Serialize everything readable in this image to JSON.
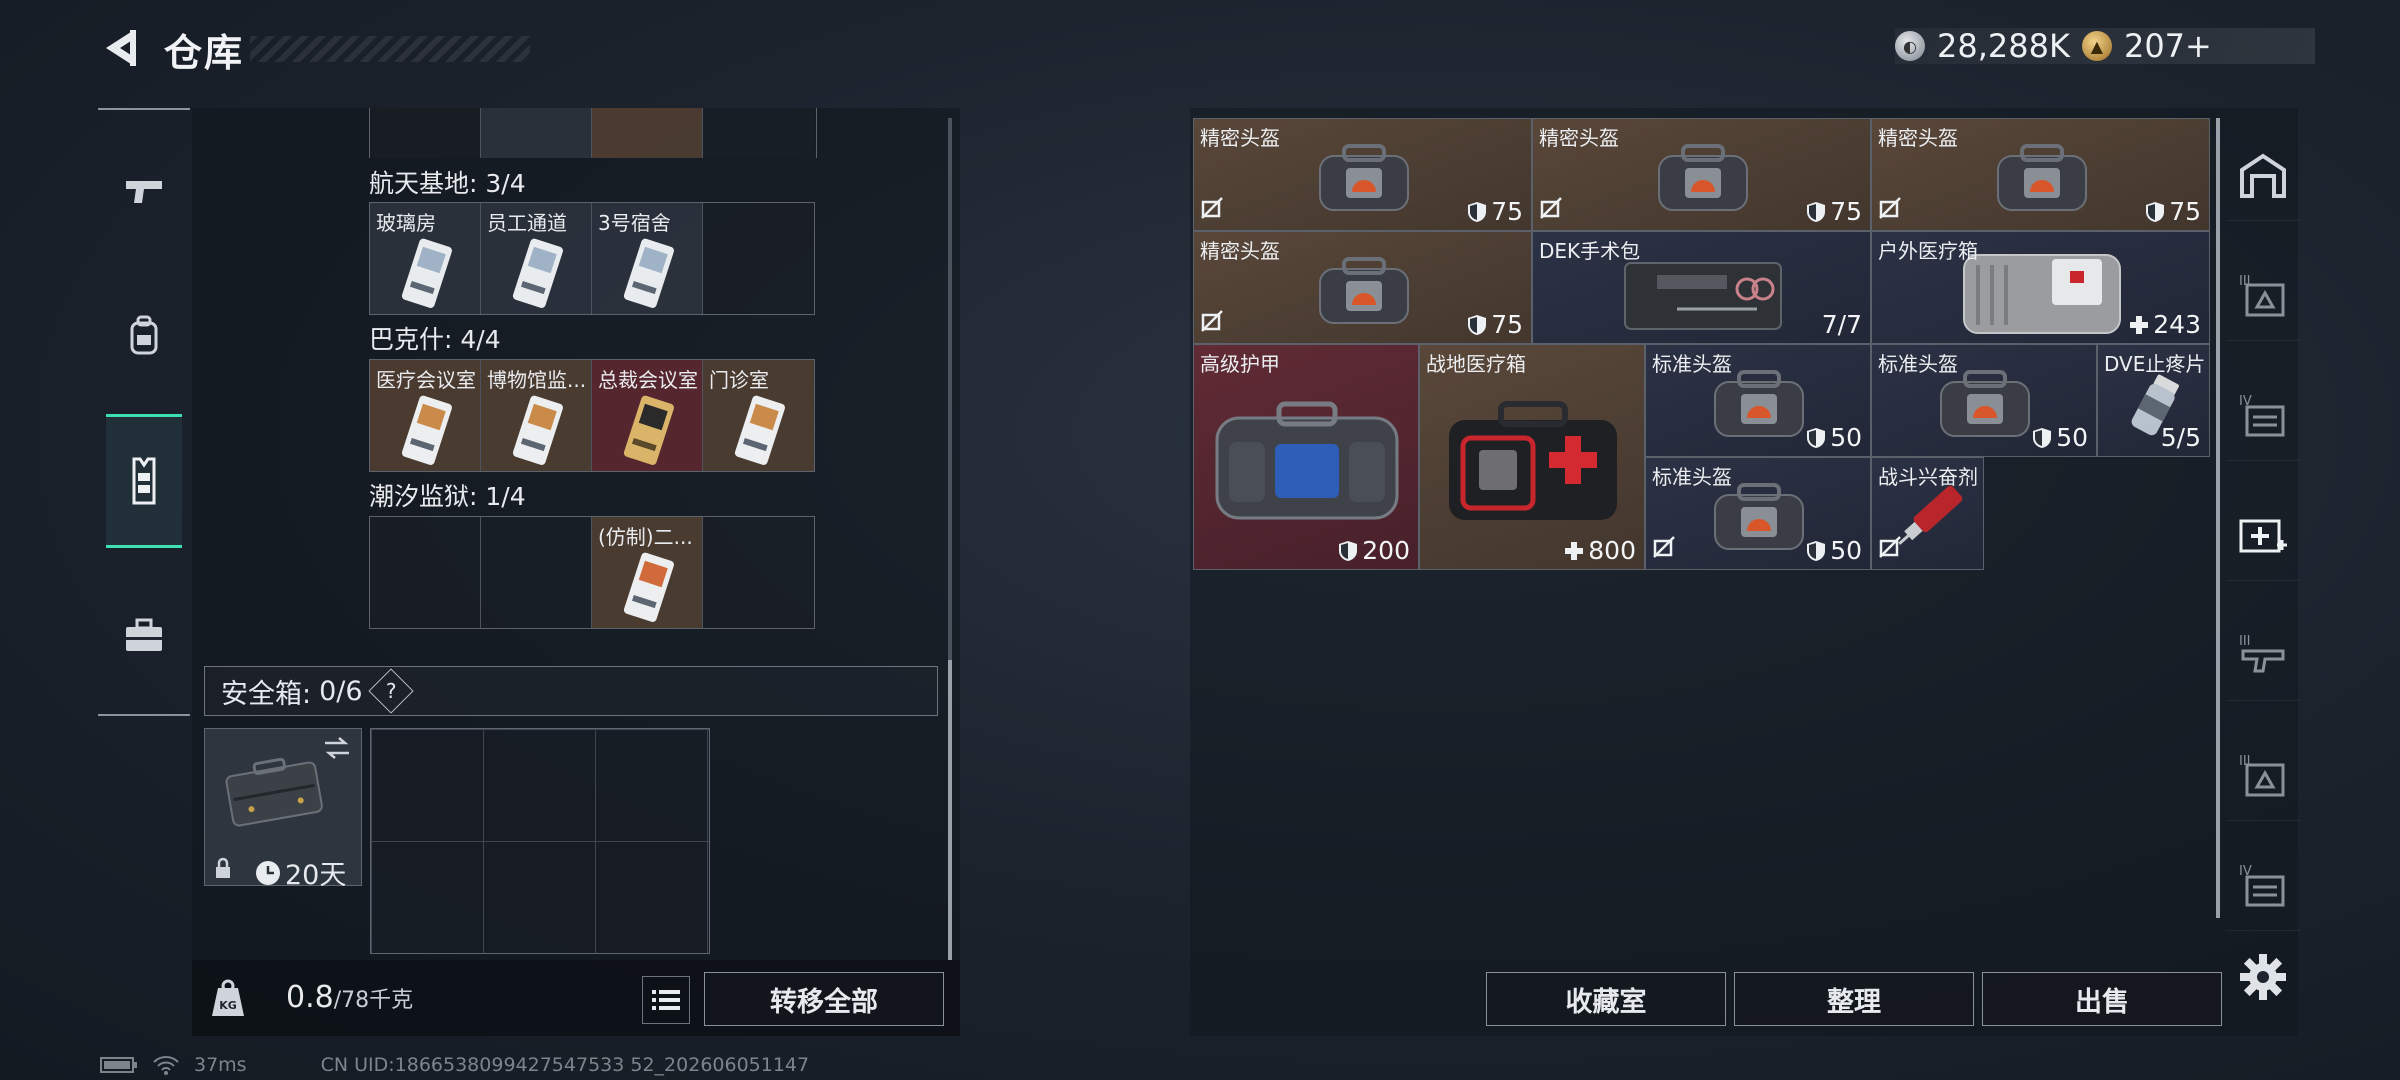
{
  "header": {
    "title": "仓库"
  },
  "currency": {
    "silver": "28,288K",
    "gold": "207+"
  },
  "left_nav": {
    "items": [
      "gun-icon",
      "backpack-icon",
      "vest-icon",
      "case-icon"
    ],
    "active_index": 2
  },
  "keycards": {
    "groups": [
      {
        "label": "航天基地: 3/4",
        "cells": [
          {
            "name": "玻璃房",
            "tone": "gray",
            "card": "white"
          },
          {
            "name": "员工通道",
            "tone": "gray",
            "card": "white"
          },
          {
            "name": "3号宿舍",
            "tone": "gray",
            "card": "white"
          },
          {
            "name": "",
            "tone": "empty",
            "card": ""
          }
        ]
      },
      {
        "label": "巴克什: 4/4",
        "cells": [
          {
            "name": "医疗会议室",
            "tone": "brown",
            "card": "white"
          },
          {
            "name": "博物馆监...",
            "tone": "brown",
            "card": "white"
          },
          {
            "name": "总裁会议室",
            "tone": "maroon",
            "card": "gold"
          },
          {
            "name": "门诊室",
            "tone": "brown",
            "card": "white"
          }
        ]
      },
      {
        "label": "潮汐监狱: 1/4",
        "cells": [
          {
            "name": "",
            "tone": "empty",
            "card": ""
          },
          {
            "name": "",
            "tone": "empty",
            "card": ""
          },
          {
            "name": "(仿制)二...",
            "tone": "brown",
            "card": "white"
          },
          {
            "name": "",
            "tone": "empty",
            "card": ""
          }
        ]
      }
    ]
  },
  "safe_box": {
    "label": "安全箱:",
    "count": "0/6",
    "help": "?",
    "days": "20天"
  },
  "weight": {
    "current": "0.8",
    "max": "/78千克"
  },
  "buttons": {
    "transfer_all": "转移全部",
    "collection": "收藏室",
    "sort": "整理",
    "sell": "出售"
  },
  "status": {
    "ping": "37ms",
    "uid": "CN UID:1866538099427547533 52_202606051147"
  },
  "items": [
    {
      "name": "精密头盔",
      "value": "75",
      "icon": "shield-icon",
      "tone": "brown",
      "nodrop": true
    },
    {
      "name": "精密头盔",
      "value": "75",
      "icon": "shield-icon",
      "tone": "brown",
      "nodrop": true
    },
    {
      "name": "精密头盔",
      "value": "75",
      "icon": "shield-icon",
      "tone": "brown",
      "nodrop": true
    },
    {
      "name": "精密头盔",
      "value": "75",
      "icon": "shield-icon",
      "tone": "brown",
      "nodrop": true
    },
    {
      "name": "DEK手术包",
      "value": "7/7",
      "icon": "",
      "tone": "navy",
      "nodrop": false
    },
    {
      "name": "户外医疗箱",
      "value": "243",
      "icon": "plus-icon",
      "tone": "navy",
      "nodrop": false
    },
    {
      "name": "高级护甲",
      "value": "200",
      "icon": "shield-icon",
      "tone": "maroon",
      "nodrop": false
    },
    {
      "name": "战地医疗箱",
      "value": "800",
      "icon": "plus-icon",
      "tone": "brown",
      "nodrop": false
    },
    {
      "name": "标准头盔",
      "value": "50",
      "icon": "shield-icon",
      "tone": "navy",
      "nodrop": false
    },
    {
      "name": "标准头盔",
      "value": "50",
      "icon": "shield-icon",
      "tone": "navy",
      "nodrop": false
    },
    {
      "name": "DVE止疼片",
      "value": "5/5",
      "icon": "",
      "tone": "navy",
      "nodrop": false
    },
    {
      "name": "标准头盔",
      "value": "50",
      "icon": "shield-icon",
      "tone": "navy",
      "nodrop": true
    },
    {
      "name": "战斗兴奋剂",
      "value": "",
      "icon": "",
      "tone": "navy",
      "nodrop": true
    }
  ]
}
